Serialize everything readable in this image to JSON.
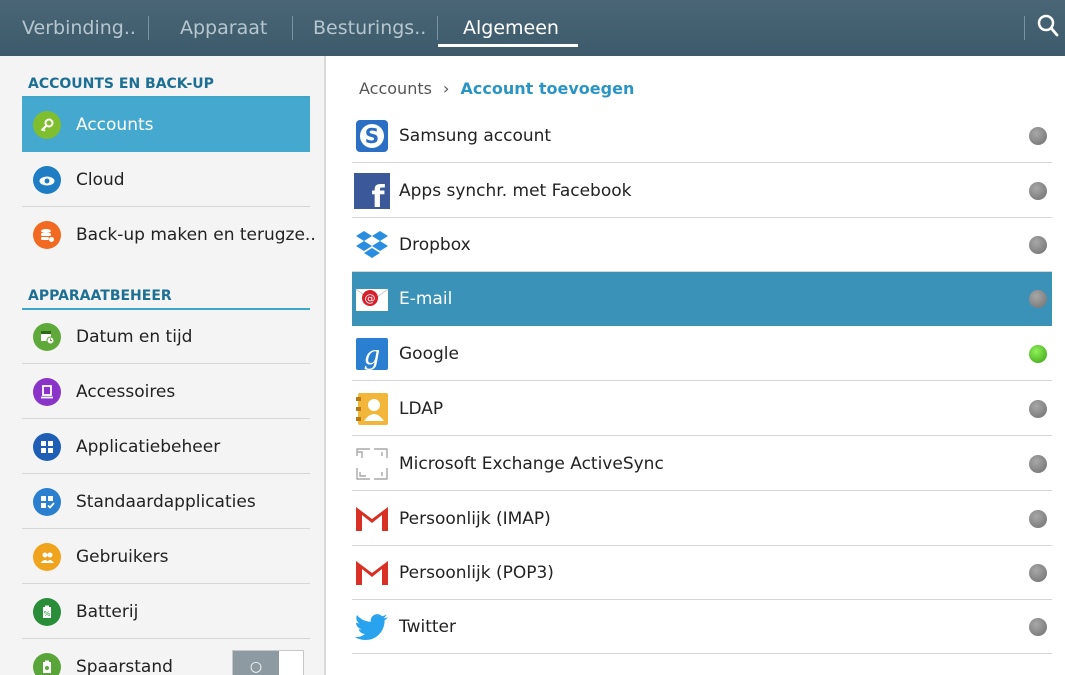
{
  "tabs": [
    {
      "label": "Verbinding.."
    },
    {
      "label": "Apparaat"
    },
    {
      "label": "Besturings.."
    },
    {
      "label": "Algemeen"
    }
  ],
  "left_panel": {
    "sections": [
      {
        "title": "ACCOUNTS EN BACK-UP"
      },
      {
        "title": "APPARAATBEHEER"
      }
    ],
    "items": [
      {
        "label": "Accounts",
        "icon": "key-icon",
        "color": "#7fbf2f",
        "selected": true
      },
      {
        "label": "Cloud",
        "icon": "cloud-icon",
        "color": "#1f7ec3"
      },
      {
        "label": "Back-up maken en terugze..",
        "icon": "backup-icon",
        "color": "#f26a21"
      },
      {
        "label": "Datum en tijd",
        "icon": "calendar-clock-icon",
        "color": "#5fa83a"
      },
      {
        "label": "Accessoires",
        "icon": "accessory-icon",
        "color": "#8a33c9"
      },
      {
        "label": "Applicatiebeheer",
        "icon": "apps-grid-icon",
        "color": "#1e5fb5"
      },
      {
        "label": "Standaardapplicaties",
        "icon": "default-apps-icon",
        "color": "#2b7fcf"
      },
      {
        "label": "Gebruikers",
        "icon": "users-icon",
        "color": "#f0a31c"
      },
      {
        "label": "Batterij",
        "icon": "battery-icon",
        "color": "#2a8d3a"
      },
      {
        "label": "Spaarstand",
        "icon": "power-saving-icon",
        "color": "#5aa53a",
        "toggle": "off"
      }
    ]
  },
  "breadcrumb": {
    "parent": "Accounts",
    "separator": "›",
    "current": "Account toevoegen"
  },
  "accounts": [
    {
      "label": "Samsung account",
      "icon": "samsung-icon",
      "status": "inactive"
    },
    {
      "label": "Apps synchr. met Facebook",
      "icon": "facebook-icon",
      "status": "inactive"
    },
    {
      "label": "Dropbox",
      "icon": "dropbox-icon",
      "status": "inactive"
    },
    {
      "label": "E-mail",
      "icon": "email-icon",
      "status": "inactive",
      "selected": true
    },
    {
      "label": "Google",
      "icon": "google-icon",
      "status": "active"
    },
    {
      "label": "LDAP",
      "icon": "ldap-icon",
      "status": "inactive"
    },
    {
      "label": "Microsoft Exchange ActiveSync",
      "icon": "exchange-icon",
      "status": "inactive"
    },
    {
      "label": "Persoonlijk (IMAP)",
      "icon": "gmail-icon",
      "status": "inactive"
    },
    {
      "label": "Persoonlijk (POP3)",
      "icon": "gmail-icon",
      "status": "inactive"
    },
    {
      "label": "Twitter",
      "icon": "twitter-icon",
      "status": "inactive"
    }
  ]
}
